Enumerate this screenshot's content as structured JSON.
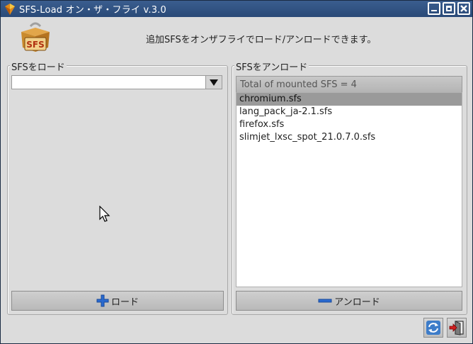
{
  "window": {
    "title": "SFS-Load オン・ザ・フライ v.3.0"
  },
  "header": {
    "message": "追加SFSをオンザフライでロード/アンロードできます。",
    "logo_text": "SFS"
  },
  "load_panel": {
    "label": "SFSをロード",
    "combo_value": "",
    "load_button": "ロード"
  },
  "unload_panel": {
    "label": "SFSをアンロード",
    "total_text": "Total of mounted SFS = 4",
    "items": [
      {
        "name": "chromium.sfs",
        "selected": true
      },
      {
        "name": "lang_pack_ja-2.1.sfs",
        "selected": false
      },
      {
        "name": "firefox.sfs",
        "selected": false
      },
      {
        "name": "slimjet_lxsc_spot_21.0.7.0.sfs",
        "selected": false
      }
    ],
    "unload_button": "アンロード"
  },
  "colors": {
    "titlebar": "#2f5285",
    "selection": "#9a9a9a",
    "load_icon": "#2a6ad0"
  },
  "icons": {
    "refresh": "refresh-icon",
    "exit": "exit-icon"
  }
}
